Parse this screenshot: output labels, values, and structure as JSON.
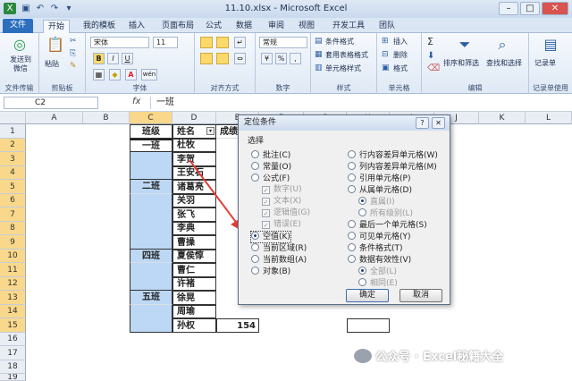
{
  "window": {
    "title": "11.10.xlsx - Microsoft Excel",
    "min": "–",
    "max": "□",
    "close": "✕"
  },
  "tabs": [
    "文件",
    "开始",
    "我的模板",
    "插入",
    "页面布局",
    "公式",
    "数据",
    "审阅",
    "视图",
    "开发工具",
    "团队"
  ],
  "ribbon": {
    "send_label": "发送到\n微信",
    "send_group": "文件传输",
    "paste_label": "粘贴",
    "clipboard_group": "剪贴板",
    "font_name": "宋体",
    "font_size": "11",
    "font_group": "字体",
    "bold": "B",
    "italic": "I",
    "underline": "U",
    "font_color": "A",
    "wen": "wén",
    "align_group": "对齐方式",
    "number_format": "常规",
    "number_group": "数字",
    "percent": "%",
    "comma": ",",
    "cond_format": "条件格式",
    "table_format": "套用表格格式",
    "cell_style": "单元格样式",
    "styles_group": "样式",
    "insert": "插入",
    "delete": "删除",
    "format": "格式",
    "cells_group": "单元格",
    "sum": "Σ",
    "sort_filter": "排序和筛选",
    "find_select": "查找和选择",
    "edit_group": "编辑",
    "record_label": "记录单",
    "record_group": "记录单使用"
  },
  "formula_bar": {
    "name_box": "C2",
    "fx": "fx",
    "value": "一班"
  },
  "grid": {
    "columns": [
      "A",
      "B",
      "C",
      "D",
      "E",
      "F",
      "G",
      "H",
      "I",
      "J",
      "K",
      "L"
    ],
    "rows": [
      "1",
      "2",
      "3",
      "4",
      "5",
      "6",
      "7",
      "8",
      "9",
      "10",
      "11",
      "12",
      "13",
      "14",
      "15",
      "16",
      "17",
      "18",
      "19"
    ],
    "header": {
      "class": "班级",
      "name": "姓名",
      "score": "成绩"
    },
    "classes": [
      "一班",
      "二班",
      "四班",
      "五班"
    ],
    "names": [
      "杜牧",
      "李贺",
      "王安石",
      "诸葛亮",
      "关羽",
      "张飞",
      "李典",
      "曹操",
      "夏侯惇",
      "曹仁",
      "许褚",
      "徐晃",
      "周瑜",
      "孙权"
    ],
    "score_last": "154"
  },
  "dialog": {
    "title": "定位条件",
    "help": "?",
    "close": "✕",
    "select_label": "选择",
    "left_options": [
      "批注(C)",
      "常量(O)",
      "公式(F)"
    ],
    "formula_sub": [
      "数字(U)",
      "文本(X)",
      "逻辑值(G)",
      "错误(E)"
    ],
    "left_options2": [
      "空值(K)",
      "当前区域(R)",
      "当前数组(A)",
      "对象(B)"
    ],
    "right_options": [
      "行内容差异单元格(W)",
      "列内容差异单元格(M)",
      "引用单元格(P)",
      "从属单元格(D)"
    ],
    "dep_sub": [
      "直属(I)",
      "所有级别(L)"
    ],
    "right_options2": [
      "最后一个单元格(S)",
      "可见单元格(Y)",
      "条件格式(T)",
      "数据有效性(V)"
    ],
    "valid_sub": [
      "全部(L)",
      "相同(E)"
    ],
    "ok": "确定",
    "cancel": "取消"
  },
  "watermark": "公众号 · Excel秘籍大全",
  "colors": {
    "accent": "#2c6fbf",
    "selection_fill": "#bcd8f5",
    "arrow": "#e0403a",
    "header_highlight": "#f9d88b"
  }
}
